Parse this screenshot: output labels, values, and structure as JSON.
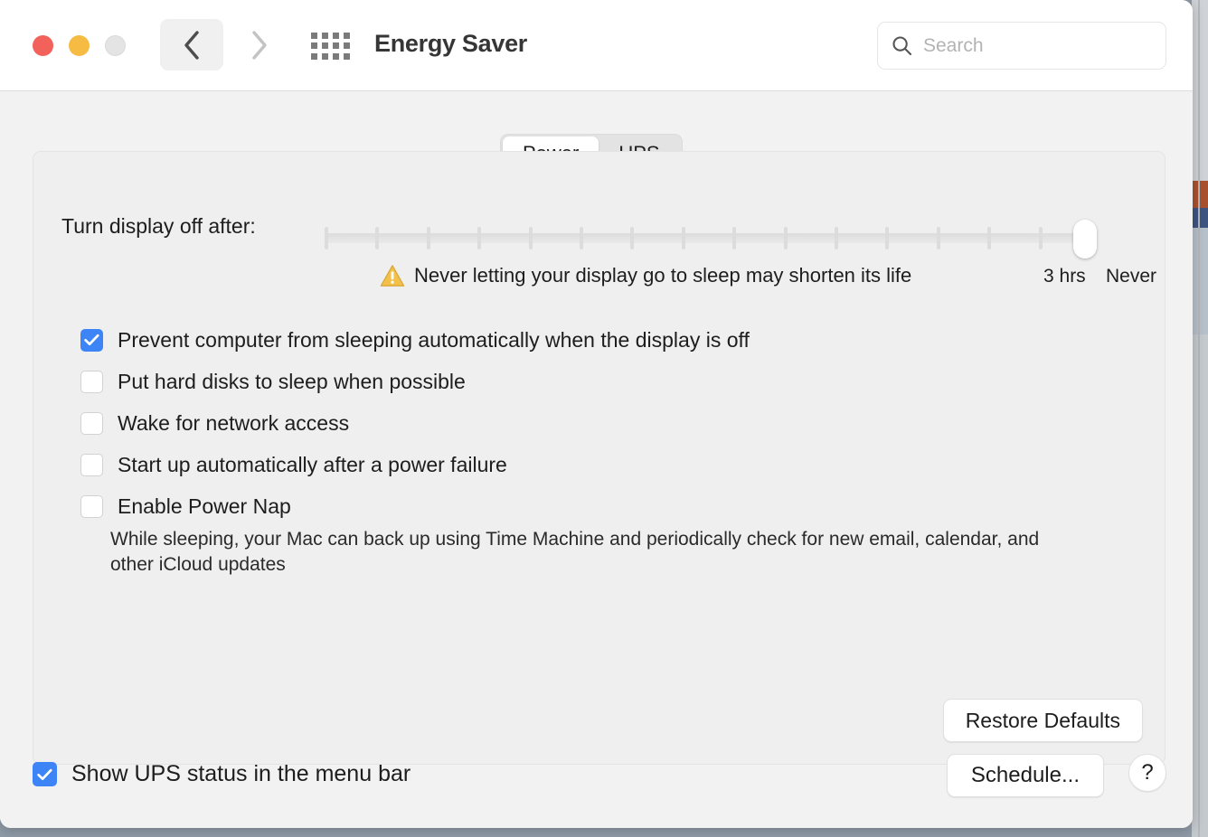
{
  "window": {
    "title": "Energy Saver",
    "traffic_lights": {
      "close": "close-button",
      "minimize": "minimize-button",
      "zoom": "zoom-button"
    },
    "nav": {
      "back_icon": "chevron-left-icon",
      "forward_icon": "chevron-right-icon",
      "grid_icon": "grid-view-icon"
    }
  },
  "search": {
    "placeholder": "Search",
    "value": "",
    "icon": "search-icon"
  },
  "tabs": [
    {
      "label": "Power",
      "active": true
    },
    {
      "label": "UPS",
      "active": false
    }
  ],
  "slider": {
    "label": "Turn display off after:",
    "value": "Never",
    "tick_count": 16,
    "tick_labels": [
      {
        "text": "3 hrs"
      },
      {
        "text": "Never"
      }
    ],
    "warning": {
      "icon": "warning-triangle-icon",
      "text": "Never letting your display go to sleep may shorten its life"
    }
  },
  "checkboxes": [
    {
      "label": "Prevent computer from sleeping automatically when the display is off",
      "checked": true
    },
    {
      "label": "Put hard disks to sleep when possible",
      "checked": false
    },
    {
      "label": "Wake for network access",
      "checked": false
    },
    {
      "label": "Start up automatically after a power failure",
      "checked": false
    },
    {
      "label": "Enable Power Nap",
      "checked": false
    }
  ],
  "power_nap_description": "While sleeping, your Mac can back up using Time Machine and periodically check for new email, calendar, and other iCloud updates",
  "buttons": {
    "restore_defaults": "Restore Defaults",
    "schedule": "Schedule...",
    "help": "?"
  },
  "footer": {
    "ups_status": {
      "label": "Show UPS status in the menu bar",
      "checked": true
    }
  },
  "colors": {
    "accent": "#3d84f7",
    "warning": "#f0b429",
    "close": "#f2625b",
    "minimize": "#f6bb42",
    "zoom": "#e4e4e4",
    "window_bg": "#f2f2f2",
    "panel_bg": "#efefef"
  }
}
